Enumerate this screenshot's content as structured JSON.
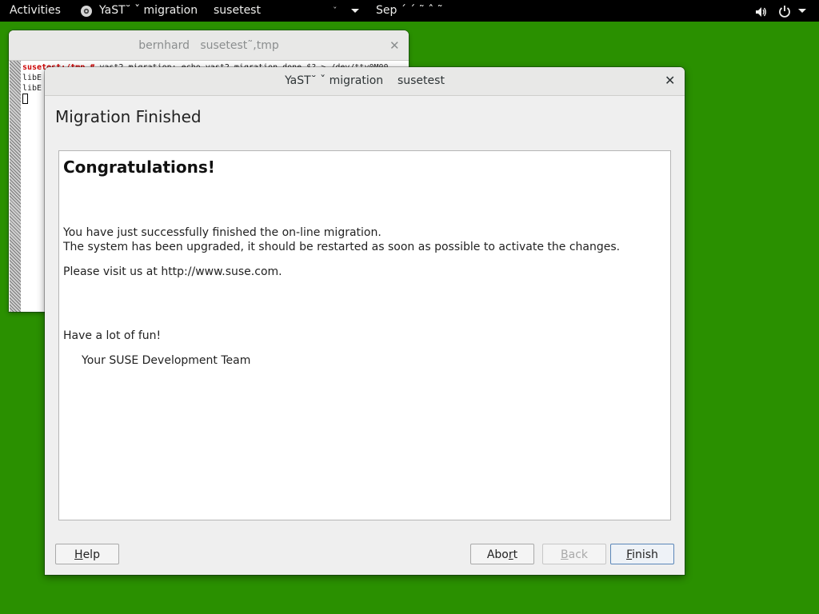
{
  "topbar": {
    "activities": "Activities",
    "app_title": "YaST˘ ˇ migration",
    "host": "susetest",
    "clock_caret": "ˇ",
    "clock": "Sep ˊ  ˊ ˜  ˆ ˜",
    "app_icon": "yast-gear-icon",
    "volume_icon": "speaker-icon",
    "power_icon": "power-icon"
  },
  "terminal": {
    "title": "bernhard   susetest˜,tmp",
    "lines": {
      "prompt": "susetest:/tmp # ",
      "cmd": "yast2 migration; echo yast2 migration done $? > /dev/tty0M00",
      "l2": "libE",
      "l3": "libE"
    }
  },
  "dialog": {
    "title": "YaST˘ ˇ migration    susetest",
    "heading": "Migration Finished",
    "congrats": "Congratulations!",
    "line1": "You have just successfully finished the on-line migration.",
    "line2": "The system has been upgraded, it should be restarted as soon as possible to activate the changes.",
    "line3": "Please visit us at http://www.suse.com.",
    "line4": "Have a lot of fun!",
    "line5": "Your SUSE Development Team",
    "buttons": {
      "help": {
        "mnemonic": "H",
        "rest": "elp"
      },
      "abort": {
        "pre": "Abo",
        "mnemonic": "r",
        "rest": "t"
      },
      "back": {
        "mnemonic": "B",
        "rest": "ack"
      },
      "finish": {
        "mnemonic": "F",
        "rest": "inish"
      }
    }
  }
}
